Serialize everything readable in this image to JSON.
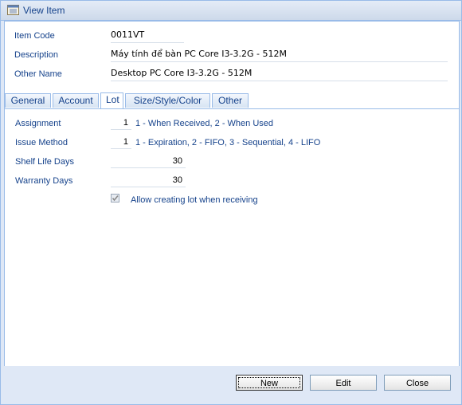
{
  "window": {
    "title": "View Item",
    "icon": "window-list-icon"
  },
  "header": {
    "item_code_label": "Item Code",
    "item_code_value": "0011VT",
    "description_label": "Description",
    "description_value": "Máy tính để bàn PC Core I3-3.2G - 512M",
    "other_name_label": "Other Name",
    "other_name_value": "Desktop PC Core I3-3.2G - 512M"
  },
  "tabs": [
    {
      "label": "General"
    },
    {
      "label": "Account"
    },
    {
      "label": "Lot",
      "active": true
    },
    {
      "label": "Size/Style/Color"
    },
    {
      "label": "Other"
    }
  ],
  "lot": {
    "assignment_label": "Assignment",
    "assignment_value": "1",
    "assignment_hint": "1 - When Received, 2 - When Used",
    "issue_method_label": "Issue Method",
    "issue_method_value": "1",
    "issue_method_hint": "1 - Expiration, 2 - FIFO, 3 - Sequential, 4 - LIFO",
    "shelf_life_label": "Shelf Life Days",
    "shelf_life_value": "30",
    "warranty_label": "Warranty Days",
    "warranty_value": "30",
    "allow_lot_label": "Allow creating lot when receiving",
    "allow_lot_checked": true
  },
  "buttons": {
    "new": "New",
    "edit": "Edit",
    "close": "Close"
  },
  "colors": {
    "accent": "#15428b",
    "border": "#99bbe8",
    "frame": "#dfe8f6"
  }
}
